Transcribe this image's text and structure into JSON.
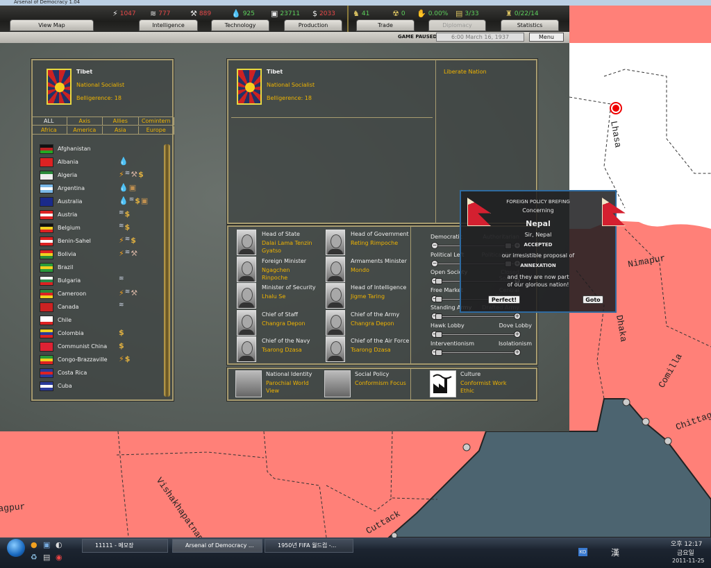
{
  "window": {
    "title": "Arsenal of Democracy 1.04"
  },
  "resources": [
    {
      "icon": "energy-icon",
      "glyph": "⚡",
      "value": "1047",
      "color": "#e84848"
    },
    {
      "icon": "metal-icon",
      "glyph": "≋",
      "value": "777",
      "color": "#e84848"
    },
    {
      "icon": "rare-materials-icon",
      "glyph": "⚒",
      "value": "889",
      "color": "#e84848"
    },
    {
      "icon": "oil-icon",
      "glyph": "💧",
      "value": "925",
      "color": "#5cd05c"
    },
    {
      "icon": "supplies-icon",
      "glyph": "▣",
      "value": "23711",
      "color": "#5cd05c"
    },
    {
      "icon": "money-icon",
      "glyph": "$",
      "value": "2033",
      "color": "#e84848"
    }
  ],
  "stats": [
    {
      "icon": "manpower-icon",
      "glyph": "♞",
      "value": "41"
    },
    {
      "icon": "nuclear-icon",
      "glyph": "☢",
      "value": "0"
    },
    {
      "icon": "dissent-icon",
      "glyph": "✋",
      "value": "0.00%"
    },
    {
      "icon": "convoy-icon",
      "glyph": "▤",
      "value": "3/33"
    },
    {
      "icon": "units-icon",
      "glyph": "♜",
      "value": "0/22/14"
    }
  ],
  "tabs": [
    "View Map",
    "Intelligence",
    "Technology",
    "Production",
    "Trade",
    "Diplomacy",
    "Statistics"
  ],
  "active_tab": "Diplomacy",
  "status": {
    "paused": "GAME PAUSED",
    "date": "6:00 March 16, 1937",
    "menu": "Menu"
  },
  "selected_country": {
    "name": "Tibet",
    "ideology": "National Socialist",
    "belligerence": "Belligerence: 18"
  },
  "filters": [
    "ALL",
    "Axis",
    "Allies",
    "Comintern",
    "Africa",
    "America",
    "Asia",
    "Europe"
  ],
  "countries": [
    {
      "name": "Afghanistan",
      "flag": [
        "#111",
        "#b22",
        "#2a2"
      ],
      "icons": []
    },
    {
      "name": "Albania",
      "flag": [
        "#d22",
        "#d22",
        "#d22"
      ],
      "icons": [
        "oil"
      ]
    },
    {
      "name": "Algeria",
      "flag": [
        "#2a8a3a",
        "#eee",
        "#eee"
      ],
      "icons": [
        "energy",
        "metal",
        "rare",
        "money"
      ]
    },
    {
      "name": "Argentina",
      "flag": [
        "#7ab8e8",
        "#fff",
        "#7ab8e8"
      ],
      "icons": [
        "oil",
        "supplies"
      ]
    },
    {
      "name": "Australia",
      "flag": [
        "#1a2a8a",
        "#1a2a8a",
        "#1a2a8a"
      ],
      "icons": [
        "oil",
        "metal",
        "money",
        "supplies"
      ]
    },
    {
      "name": "Austria",
      "flag": [
        "#d22",
        "#fff",
        "#d22"
      ],
      "icons": [
        "metal",
        "money"
      ]
    },
    {
      "name": "Belgium",
      "flag": [
        "#111",
        "#f0d020",
        "#d22"
      ],
      "icons": [
        "metal",
        "money"
      ]
    },
    {
      "name": "Benin-Sahel",
      "flag": [
        "#d22",
        "#fff",
        "#d22"
      ],
      "icons": [
        "energy",
        "metal",
        "money"
      ]
    },
    {
      "name": "Bolivia",
      "flag": [
        "#d22",
        "#f0d020",
        "#2a8a3a"
      ],
      "icons": [
        "energy",
        "metal",
        "rare"
      ]
    },
    {
      "name": "Brazil",
      "flag": [
        "#2a9a3a",
        "#f0d020",
        "#2a9a3a"
      ],
      "icons": []
    },
    {
      "name": "Bulgaria",
      "flag": [
        "#fff",
        "#2a8a4a",
        "#d22"
      ],
      "icons": [
        "metal"
      ]
    },
    {
      "name": "Cameroon",
      "flag": [
        "#2a8a3a",
        "#d22",
        "#f0d020"
      ],
      "icons": [
        "energy",
        "metal",
        "rare"
      ]
    },
    {
      "name": "Canada",
      "flag": [
        "#c22",
        "#c22",
        "#c22"
      ],
      "icons": [
        "metal"
      ]
    },
    {
      "name": "Chile",
      "flag": [
        "#fff",
        "#fff",
        "#d22"
      ],
      "icons": []
    },
    {
      "name": "Colombia",
      "flag": [
        "#f0d020",
        "#2a3a9a",
        "#d22"
      ],
      "icons": [
        "money"
      ]
    },
    {
      "name": "Communist China",
      "flag": [
        "#d23",
        "#d23",
        "#d23"
      ],
      "icons": [
        "money"
      ]
    },
    {
      "name": "Congo-Brazzaville",
      "flag": [
        "#2a9a3a",
        "#f0d020",
        "#d22"
      ],
      "icons": [
        "energy",
        "money"
      ]
    },
    {
      "name": "Costa Rica",
      "flag": [
        "#2a3a9a",
        "#d22",
        "#2a3a9a"
      ],
      "icons": []
    },
    {
      "name": "Cuba",
      "flag": [
        "#2a3a9a",
        "#fff",
        "#2a3a9a"
      ],
      "icons": []
    }
  ],
  "icon_glyphs": {
    "energy": "⚡",
    "metal": "≋",
    "rare": "⚒",
    "oil": "💧",
    "supplies": "▣",
    "money": "$"
  },
  "actions": {
    "liberate": "Liberate Nation"
  },
  "ministers": [
    {
      "role": "Head of State",
      "name": "Dalai Lama Tenzin Gyatso"
    },
    {
      "role": "Head of Government",
      "name": "Reting Rimpoche"
    },
    {
      "role": "Foreign Minister",
      "name": "Ngagchen Rinpoche"
    },
    {
      "role": "Armaments Minister",
      "name": "Mondo"
    },
    {
      "role": "Minister of Security",
      "name": "Lhalu Se"
    },
    {
      "role": "Head of Intelligence",
      "name": "Jigme Taring"
    },
    {
      "role": "Chief of Staff",
      "name": "Changra Depon"
    },
    {
      "role": "Chief of the Army",
      "name": "Changra Depon"
    },
    {
      "role": "Chief of the Navy",
      "name": "Tsarong Dzasa"
    },
    {
      "role": "Chief of the Air Force",
      "name": "Tsarong Dzasa"
    }
  ],
  "sliders": [
    {
      "left": "Democratic",
      "right": "Authoritarian",
      "value": 1.0
    },
    {
      "left": "Political Left",
      "right": "Political Right",
      "value": 1.0
    },
    {
      "left": "Open Society",
      "right": "Closed Society",
      "value": 0.0
    },
    {
      "left": "Free Market",
      "right": "Central Planning",
      "value": 0.0
    },
    {
      "left": "Standing Army",
      "right": "Drafted Army",
      "value": 0.0
    },
    {
      "left": "Hawk Lobby",
      "right": "Dove Lobby",
      "value": 0.0
    },
    {
      "left": "Interventionism",
      "right": "Isolationism",
      "value": 0.0
    }
  ],
  "policies": [
    {
      "label": "National Identity",
      "value": "Parochial World View"
    },
    {
      "label": "Social Policy",
      "value": "Conformism Focus"
    },
    {
      "label": "Culture",
      "value": "Conformist Work Ethic"
    }
  ],
  "popup": {
    "title": "FOREIGN POLICY BREFING",
    "concerning": "Concerning",
    "country": "Nepal",
    "from": "Sir, Nepal",
    "status": "ACCEPTED",
    "line1": "our irresistible proposal of",
    "proposal": "ANNEXATION",
    "line2": "and they are now part of our glorious nation!",
    "ok": "Perfect!",
    "goto": "Goto"
  },
  "map_labels": [
    "Lhasa",
    "Nimapur",
    "Dhaka",
    "Comilla",
    "Chittagong",
    "Vishakhapatnam",
    "Cuttack",
    "Nagpur"
  ],
  "taskbar": {
    "windows": [
      "11111 - 메모장",
      "Arsenal of Democracy ...",
      "1950년 FIFA 월드컵 -..."
    ],
    "time": "오후 12:17",
    "day": "금요일",
    "date": "2011-11-25",
    "ime": "KO",
    "hanja": "漢"
  }
}
